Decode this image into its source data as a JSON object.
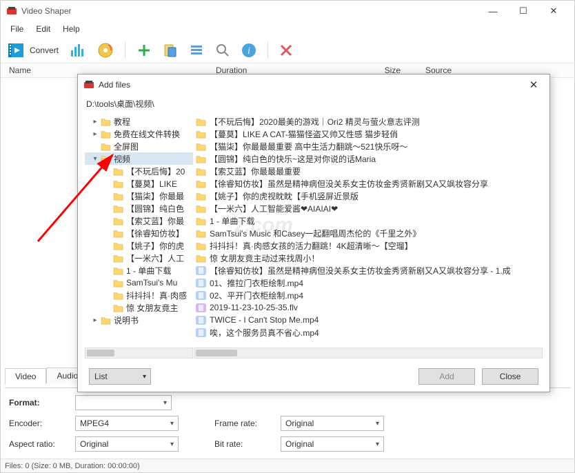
{
  "app": {
    "title": "Video Shaper"
  },
  "menu": {
    "file": "File",
    "edit": "Edit",
    "help": "Help"
  },
  "toolbar": {
    "convert": "Convert"
  },
  "columns": {
    "name": "Name",
    "duration": "Duration",
    "size": "Size",
    "source": "Source"
  },
  "tabs": {
    "video": "Video",
    "audio": "Audio"
  },
  "settings": {
    "format_label": "Format:",
    "format_value": "",
    "encoder_label": "Encoder:",
    "encoder_value": "MPEG4",
    "frame_rate_label": "Frame rate:",
    "frame_rate_value": "Original",
    "aspect_label": "Aspect ratio:",
    "aspect_value": "Original",
    "bitrate_label": "Bit rate:",
    "bitrate_value": "Original"
  },
  "status": "Files: 0 (Size: 0 MB, Duration: 00:00:00)",
  "dialog": {
    "title": "Add files",
    "path": "D:\\tools\\桌面\\视频\\",
    "view_mode": "List",
    "add": "Add",
    "close": "Close",
    "tree": [
      {
        "indent": 0,
        "exp": ">",
        "type": "folder",
        "label": "教程"
      },
      {
        "indent": 0,
        "exp": ">",
        "type": "folder",
        "label": "免费在线文件转换"
      },
      {
        "indent": 0,
        "exp": "",
        "type": "folder",
        "label": "全屏图"
      },
      {
        "indent": 0,
        "exp": "v",
        "type": "folder-open",
        "label": "视频",
        "sel": true
      },
      {
        "indent": 1,
        "exp": "",
        "type": "folder",
        "label": "【不玩后悔】20"
      },
      {
        "indent": 1,
        "exp": "",
        "type": "folder",
        "label": "【蔓莫】LIKE "
      },
      {
        "indent": 1,
        "exp": "",
        "type": "folder",
        "label": "【猫柒】你最最"
      },
      {
        "indent": 1,
        "exp": "",
        "type": "folder",
        "label": "【圆锦】纯白色"
      },
      {
        "indent": 1,
        "exp": "",
        "type": "folder",
        "label": "【索艾蓝】你最"
      },
      {
        "indent": 1,
        "exp": "",
        "type": "folder",
        "label": "【徐睿知仿妆】"
      },
      {
        "indent": 1,
        "exp": "",
        "type": "folder",
        "label": "【姚子】你的虎"
      },
      {
        "indent": 1,
        "exp": "",
        "type": "folder",
        "label": "【一米六】人工"
      },
      {
        "indent": 1,
        "exp": "",
        "type": "folder",
        "label": "1 - 单曲下载"
      },
      {
        "indent": 1,
        "exp": "",
        "type": "folder",
        "label": "SamTsui's Mu"
      },
      {
        "indent": 1,
        "exp": "",
        "type": "folder",
        "label": "抖抖抖！真·肉感"
      },
      {
        "indent": 1,
        "exp": "",
        "type": "folder",
        "label": "惊 女朋友竟主"
      },
      {
        "indent": 0,
        "exp": ">",
        "type": "folder",
        "label": "说明书"
      }
    ],
    "list": [
      {
        "type": "folder",
        "label": "【不玩后悔】2020最美的游戏｜Ori2 精灵与萤火意志评测"
      },
      {
        "type": "folder",
        "label": "【蔓莫】LIKE A CAT-猫猫怪盗又帅又性感 猫步轻俏"
      },
      {
        "type": "folder",
        "label": "【猫柒】你最最最重要  高中生活力翻跳～521快乐呀～"
      },
      {
        "type": "folder",
        "label": "【圆锦】纯白色的快乐~这是对你说的话Maria"
      },
      {
        "type": "folder",
        "label": "【索艾蓝】你最最最重要"
      },
      {
        "type": "folder",
        "label": "【徐睿知仿妆】虽然是精神病但没关系女主仿妆金秀贤新剧又A又飒妆容分享"
      },
      {
        "type": "folder",
        "label": "【姚子】你的虎视眈眈【手机竖屏近景版"
      },
      {
        "type": "folder",
        "label": "【一米六】人工智能爱酱❤AIAIAI❤"
      },
      {
        "type": "folder",
        "label": "1 - 单曲下载"
      },
      {
        "type": "folder",
        "label": "SamTsui's Music  和Casey一起翻唱周杰伦的《千里之外》"
      },
      {
        "type": "folder",
        "label": "抖抖抖！真·肉感女孩的活力翻跳！4K超清晰～【空瑠】"
      },
      {
        "type": "folder",
        "label": "惊 女朋友竟主动过来找周小！"
      },
      {
        "type": "video",
        "label": "【徐睿知仿妆】虽然是精神病但没关系女主仿妆金秀贤新剧又A又飒妆容分享 - 1.成"
      },
      {
        "type": "video",
        "label": "01、推拉门衣柜绘制.mp4"
      },
      {
        "type": "video",
        "label": "02、平开门衣柜绘制.mp4"
      },
      {
        "type": "flv",
        "label": "2019-11-23-10-25-35.flv"
      },
      {
        "type": "video",
        "label": "TWICE - I Can't Stop Me.mp4"
      },
      {
        "type": "video",
        "label": "唉，这个服务员真不省心.mp4"
      }
    ]
  }
}
